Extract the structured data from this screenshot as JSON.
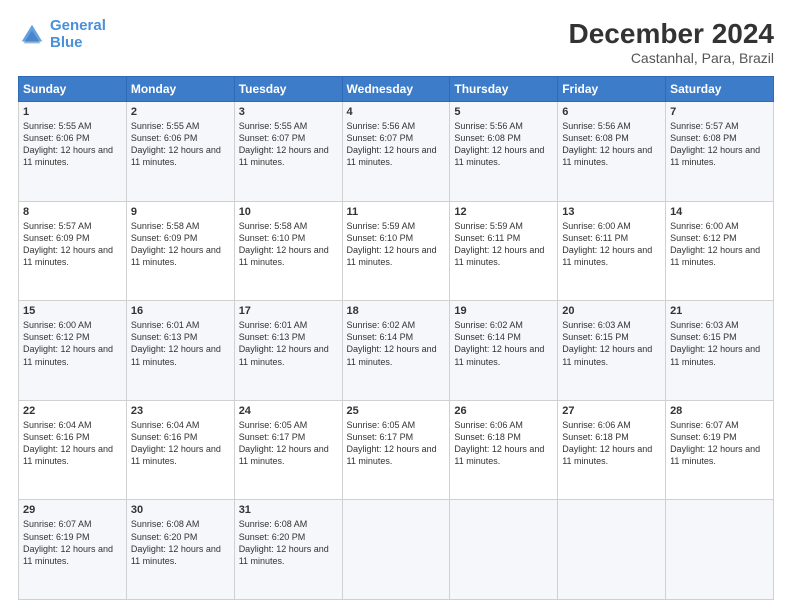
{
  "logo": {
    "line1": "General",
    "line2": "Blue"
  },
  "title": "December 2024",
  "subtitle": "Castanhal, Para, Brazil",
  "headers": [
    "Sunday",
    "Monday",
    "Tuesday",
    "Wednesday",
    "Thursday",
    "Friday",
    "Saturday"
  ],
  "weeks": [
    [
      {
        "day": "1",
        "sunrise": "5:55 AM",
        "sunset": "6:06 PM",
        "daylight": "12 hours and 11 minutes."
      },
      {
        "day": "2",
        "sunrise": "5:55 AM",
        "sunset": "6:06 PM",
        "daylight": "12 hours and 11 minutes."
      },
      {
        "day": "3",
        "sunrise": "5:55 AM",
        "sunset": "6:07 PM",
        "daylight": "12 hours and 11 minutes."
      },
      {
        "day": "4",
        "sunrise": "5:56 AM",
        "sunset": "6:07 PM",
        "daylight": "12 hours and 11 minutes."
      },
      {
        "day": "5",
        "sunrise": "5:56 AM",
        "sunset": "6:08 PM",
        "daylight": "12 hours and 11 minutes."
      },
      {
        "day": "6",
        "sunrise": "5:56 AM",
        "sunset": "6:08 PM",
        "daylight": "12 hours and 11 minutes."
      },
      {
        "day": "7",
        "sunrise": "5:57 AM",
        "sunset": "6:08 PM",
        "daylight": "12 hours and 11 minutes."
      }
    ],
    [
      {
        "day": "8",
        "sunrise": "5:57 AM",
        "sunset": "6:09 PM",
        "daylight": "12 hours and 11 minutes."
      },
      {
        "day": "9",
        "sunrise": "5:58 AM",
        "sunset": "6:09 PM",
        "daylight": "12 hours and 11 minutes."
      },
      {
        "day": "10",
        "sunrise": "5:58 AM",
        "sunset": "6:10 PM",
        "daylight": "12 hours and 11 minutes."
      },
      {
        "day": "11",
        "sunrise": "5:59 AM",
        "sunset": "6:10 PM",
        "daylight": "12 hours and 11 minutes."
      },
      {
        "day": "12",
        "sunrise": "5:59 AM",
        "sunset": "6:11 PM",
        "daylight": "12 hours and 11 minutes."
      },
      {
        "day": "13",
        "sunrise": "6:00 AM",
        "sunset": "6:11 PM",
        "daylight": "12 hours and 11 minutes."
      },
      {
        "day": "14",
        "sunrise": "6:00 AM",
        "sunset": "6:12 PM",
        "daylight": "12 hours and 11 minutes."
      }
    ],
    [
      {
        "day": "15",
        "sunrise": "6:00 AM",
        "sunset": "6:12 PM",
        "daylight": "12 hours and 11 minutes."
      },
      {
        "day": "16",
        "sunrise": "6:01 AM",
        "sunset": "6:13 PM",
        "daylight": "12 hours and 11 minutes."
      },
      {
        "day": "17",
        "sunrise": "6:01 AM",
        "sunset": "6:13 PM",
        "daylight": "12 hours and 11 minutes."
      },
      {
        "day": "18",
        "sunrise": "6:02 AM",
        "sunset": "6:14 PM",
        "daylight": "12 hours and 11 minutes."
      },
      {
        "day": "19",
        "sunrise": "6:02 AM",
        "sunset": "6:14 PM",
        "daylight": "12 hours and 11 minutes."
      },
      {
        "day": "20",
        "sunrise": "6:03 AM",
        "sunset": "6:15 PM",
        "daylight": "12 hours and 11 minutes."
      },
      {
        "day": "21",
        "sunrise": "6:03 AM",
        "sunset": "6:15 PM",
        "daylight": "12 hours and 11 minutes."
      }
    ],
    [
      {
        "day": "22",
        "sunrise": "6:04 AM",
        "sunset": "6:16 PM",
        "daylight": "12 hours and 11 minutes."
      },
      {
        "day": "23",
        "sunrise": "6:04 AM",
        "sunset": "6:16 PM",
        "daylight": "12 hours and 11 minutes."
      },
      {
        "day": "24",
        "sunrise": "6:05 AM",
        "sunset": "6:17 PM",
        "daylight": "12 hours and 11 minutes."
      },
      {
        "day": "25",
        "sunrise": "6:05 AM",
        "sunset": "6:17 PM",
        "daylight": "12 hours and 11 minutes."
      },
      {
        "day": "26",
        "sunrise": "6:06 AM",
        "sunset": "6:18 PM",
        "daylight": "12 hours and 11 minutes."
      },
      {
        "day": "27",
        "sunrise": "6:06 AM",
        "sunset": "6:18 PM",
        "daylight": "12 hours and 11 minutes."
      },
      {
        "day": "28",
        "sunrise": "6:07 AM",
        "sunset": "6:19 PM",
        "daylight": "12 hours and 11 minutes."
      }
    ],
    [
      {
        "day": "29",
        "sunrise": "6:07 AM",
        "sunset": "6:19 PM",
        "daylight": "12 hours and 11 minutes."
      },
      {
        "day": "30",
        "sunrise": "6:08 AM",
        "sunset": "6:20 PM",
        "daylight": "12 hours and 11 minutes."
      },
      {
        "day": "31",
        "sunrise": "6:08 AM",
        "sunset": "6:20 PM",
        "daylight": "12 hours and 11 minutes."
      },
      null,
      null,
      null,
      null
    ]
  ]
}
